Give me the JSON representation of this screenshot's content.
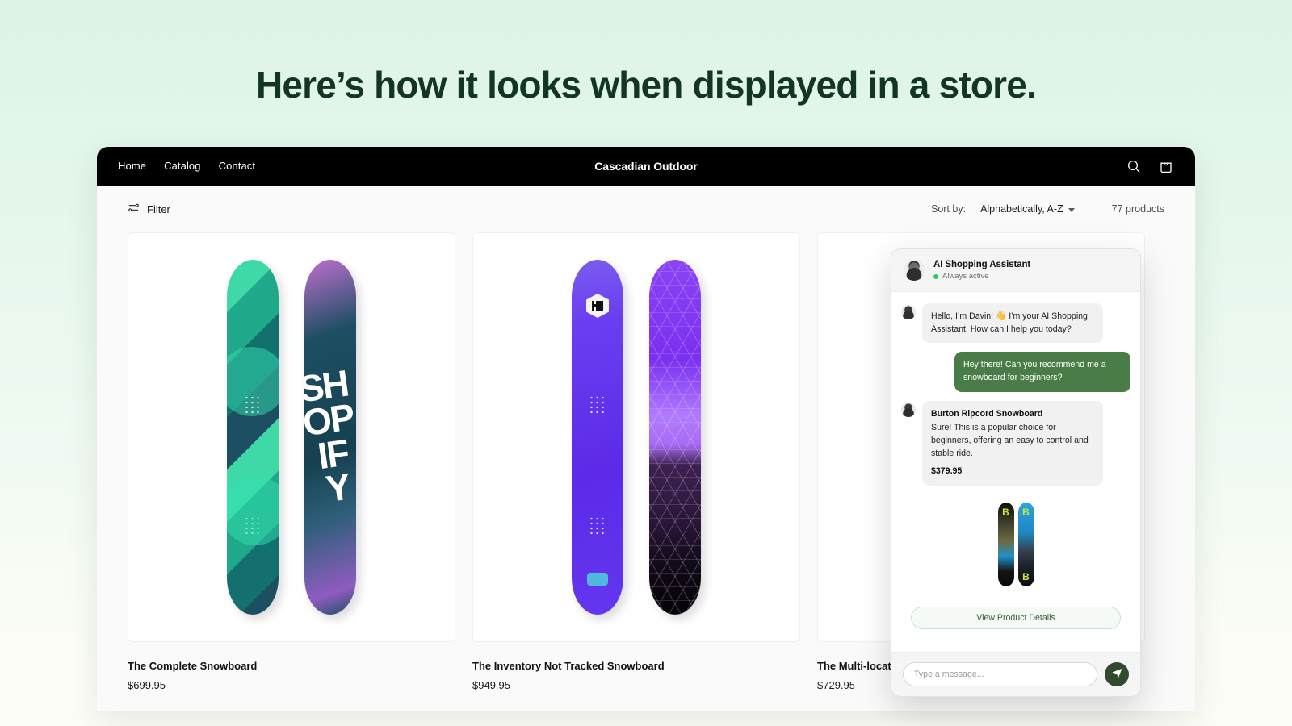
{
  "headline": "Here’s how it looks when displayed in a store.",
  "colors": {
    "page_gradient_top": "#ddf4e6",
    "page_gradient_bottom": "#fdfdf7",
    "headline": "#133524",
    "navbar": "#000000",
    "user_bubble": "#4a7c48",
    "send_button": "#2f4a2c",
    "status_dot": "#34c759"
  },
  "store": {
    "nav": {
      "links": [
        {
          "label": "Home",
          "active": false
        },
        {
          "label": "Catalog",
          "active": true
        },
        {
          "label": "Contact",
          "active": false
        }
      ],
      "brand": "Cascadian Outdoor",
      "icons": [
        {
          "name": "search-icon"
        },
        {
          "name": "shopping-bag-icon"
        }
      ]
    },
    "toolbar": {
      "filter_label": "Filter",
      "filter_icon": "sliders-icon",
      "sort_label": "Sort by:",
      "sort_value": "Alphabetically, A-Z",
      "sort_caret": "chevron-down-icon",
      "product_count": "77 products"
    },
    "products": [
      {
        "title": "The Complete Snowboard",
        "price": "$699.95"
      },
      {
        "title": "The Inventory Not Tracked Snowboard",
        "price": "$949.95"
      },
      {
        "title": "The Multi-location",
        "price": "$729.95"
      }
    ]
  },
  "chat": {
    "header": {
      "title": "AI Shopping Assistant",
      "status": "Always active",
      "avatar": "assistant-avatar"
    },
    "messages": [
      {
        "sender": "bot",
        "text": "Hello, I’m Davin! 👋 I’m your AI Shopping Assistant. How can I help you today?"
      },
      {
        "sender": "user",
        "text": "Hey there! Can you recommend me a snowboard for beginners?"
      }
    ],
    "recommendation": {
      "product_name": "Burton Ripcord Snowboard",
      "description": "Sure! This is a popular choice for beginners, offering an easy to control and stable ride.",
      "price": "$379.95",
      "cta_label": "View Product Details",
      "board_letter_top": "B",
      "board_letter_bottom": "B"
    },
    "footer": {
      "input_value": "",
      "input_placeholder": "Type a message...",
      "send_icon": "send-paper-plane-icon"
    }
  }
}
